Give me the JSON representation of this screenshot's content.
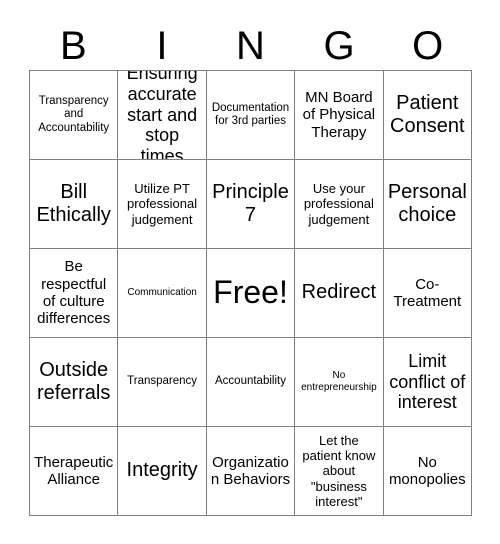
{
  "header": {
    "letters": [
      "B",
      "I",
      "N",
      "G",
      "O"
    ]
  },
  "grid": {
    "columns": 5,
    "rows": 5,
    "cells": [
      {
        "text": "Transparency and Accountability",
        "size": "xs"
      },
      {
        "text": "Ensuring accurate start and stop times",
        "size": "l"
      },
      {
        "text": "Documentation for 3rd parties",
        "size": "xs"
      },
      {
        "text": "MN Board of Physical Therapy",
        "size": "m"
      },
      {
        "text": "Patient Consent",
        "size": "xl"
      },
      {
        "text": "Bill Ethically",
        "size": "xl"
      },
      {
        "text": "Utilize PT professional judgement",
        "size": "s"
      },
      {
        "text": "Principle 7",
        "size": "xl"
      },
      {
        "text": "Use your professional judgement",
        "size": "s"
      },
      {
        "text": "Personal choice",
        "size": "xl"
      },
      {
        "text": "Be respectful of culture differences",
        "size": "m"
      },
      {
        "text": "Communication",
        "size": "xxs"
      },
      {
        "text": "Free!",
        "size": "xxl"
      },
      {
        "text": "Redirect",
        "size": "xl"
      },
      {
        "text": "Co-Treatment",
        "size": "m"
      },
      {
        "text": "Outside referrals",
        "size": "xl"
      },
      {
        "text": "Transparency",
        "size": "xs"
      },
      {
        "text": "Accountability",
        "size": "xs"
      },
      {
        "text": "No entrepreneurship",
        "size": "xxs"
      },
      {
        "text": "Limit conflict of interest",
        "size": "l"
      },
      {
        "text": "Therapeutic Alliance",
        "size": "m"
      },
      {
        "text": "Integrity",
        "size": "xl"
      },
      {
        "text": "Organization Behaviors",
        "size": "m"
      },
      {
        "text": "Let the patient know about \"business interest\"",
        "size": "s"
      },
      {
        "text": "No monopolies",
        "size": "m"
      }
    ]
  },
  "colors": {
    "background": "#ffffff",
    "text": "#000000",
    "gridline": "#808080"
  }
}
